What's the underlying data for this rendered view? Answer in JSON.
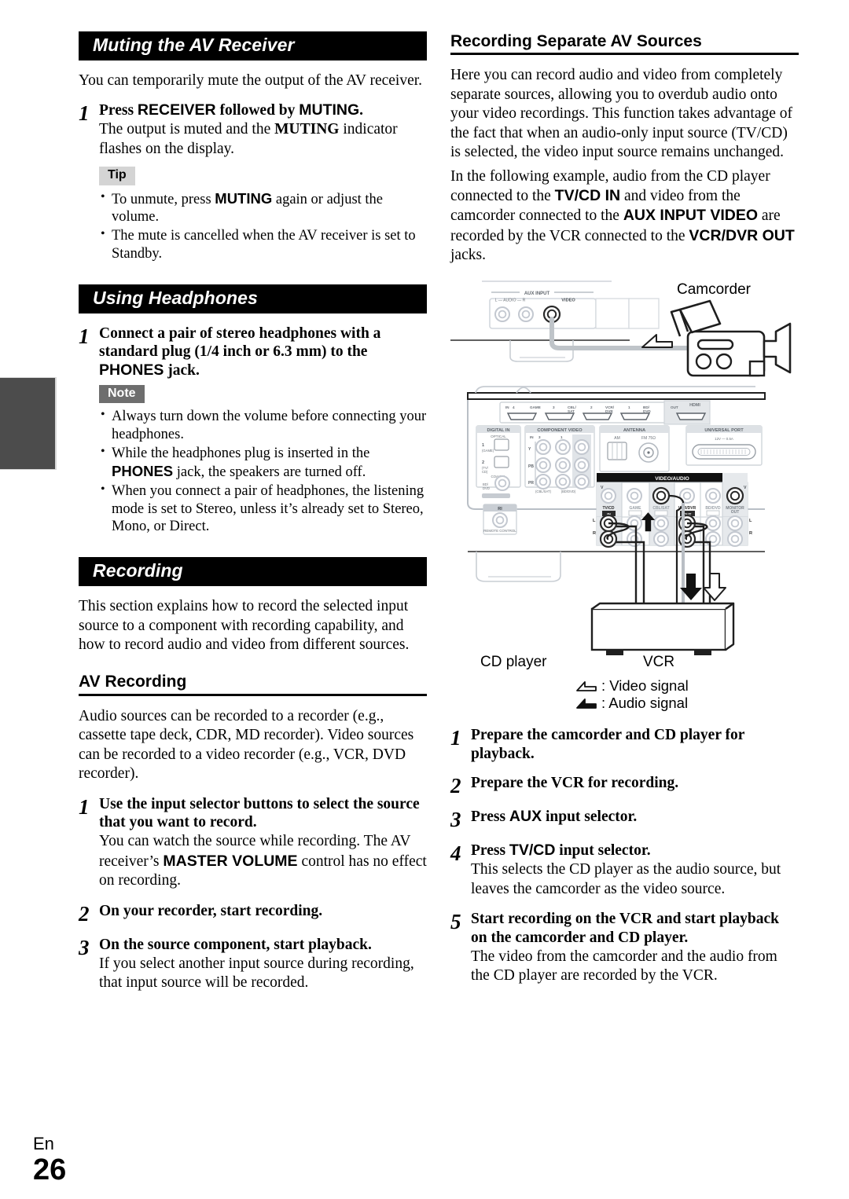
{
  "page": {
    "language_code": "En",
    "page_number": "26"
  },
  "left_column": {
    "section_muting": {
      "banner": "Muting the AV Receiver",
      "intro": "You can temporarily mute the output of the AV receiver.",
      "step": {
        "number": "1",
        "title_parts": [
          "Press ",
          "RECEIVER",
          " followed by ",
          "MUTING",
          "."
        ],
        "desc_parts": [
          "The output is muted and the ",
          "MUTING",
          " indicator flashes on the display."
        ]
      },
      "tip_badge": "Tip",
      "tip_bullets": [
        [
          "To unmute, press ",
          "MUTING",
          " again or adjust the volume."
        ],
        [
          "The mute is cancelled when the AV receiver is set to Standby.",
          "",
          ""
        ]
      ]
    },
    "section_headphones": {
      "banner": "Using Headphones",
      "step": {
        "number": "1",
        "title_parts": [
          "Connect a pair of stereo headphones with a standard plug (1/4 inch or 6.3 mm) to the ",
          "PHONES",
          " jack."
        ]
      },
      "note_badge": "Note",
      "note_bullets": [
        [
          "Always turn down the volume before connecting your headphones.",
          "",
          ""
        ],
        [
          "While the headphones plug is inserted in the ",
          "PHONES",
          " jack, the speakers are turned off."
        ],
        [
          "When you connect a pair of headphones, the listening mode is set to Stereo, unless it’s already set to Stereo, Mono, or Direct.",
          "",
          ""
        ]
      ]
    },
    "section_recording": {
      "banner": "Recording",
      "intro": "This section explains how to record the selected input source to a component with recording capability, and how to record audio and video from different sources.",
      "subhead": "AV Recording",
      "body": "Audio sources can be recorded to a recorder (e.g., cassette tape deck, CDR, MD recorder). Video sources can be recorded to a video recorder (e.g., VCR, DVD recorder).",
      "steps": [
        {
          "number": "1",
          "title": "Use the input selector buttons to select the source that you want to record.",
          "desc_parts": [
            "You can watch the source while recording. The AV receiver’s ",
            "MASTER VOLUME",
            " control has no effect on recording."
          ]
        },
        {
          "number": "2",
          "title": "On your recorder, start recording.",
          "desc_parts": [
            "",
            "",
            ""
          ]
        },
        {
          "number": "3",
          "title": "On the source component, start playback.",
          "desc_parts": [
            "If you select another input source during recording, that input source will be recorded.",
            "",
            ""
          ]
        }
      ]
    }
  },
  "right_column": {
    "subhead": "Recording Separate AV Sources",
    "para1": "Here you can record audio and video from completely separate sources, allowing you to overdub audio onto your video recordings. This function takes advantage of the fact that when an audio-only input source (TV/CD) is selected, the video input source remains unchanged.",
    "para2_parts": [
      "In the following example, audio from the CD player connected to the ",
      "TV/CD IN",
      " and video from the camcorder connected to the ",
      "AUX INPUT VIDEO",
      " are recorded by the VCR connected to the ",
      "VCR/DVR OUT",
      " jacks."
    ],
    "diagram": {
      "camcorder_label": "Camcorder",
      "cd_player_label": "CD player",
      "vcr_label": "VCR",
      "legend": [
        {
          "icon": "video-signal-arrow",
          "text": ": Video signal"
        },
        {
          "icon": "audio-signal-arrow",
          "text": ": Audio signal"
        }
      ],
      "front_panel": {
        "group_label": "AUX INPUT",
        "audio_label": "L — AUDIO — R",
        "video_label": "VIDEO"
      },
      "rear_panel": {
        "hdmi_row": [
          {
            "num": "4",
            "name": "GAME"
          },
          {
            "num": "3",
            "name": "CBL/SAT"
          },
          {
            "num": "2",
            "name": "VCR/DVR"
          },
          {
            "num": "1",
            "name": "BD/DVD"
          },
          {
            "num": "",
            "name": "OUT"
          }
        ],
        "hdmi_title": "HDMI",
        "digital_in": {
          "title": "DIGITAL IN",
          "optical": "OPTICAL",
          "ch1": "1",
          "ch1_name": "GAME",
          "ch2": "2",
          "ch2_name": "TV/CD",
          "coaxial": "COAXIAL",
          "coax_name": "BD/DVD"
        },
        "component_video": {
          "title": "COMPONENT VIDEO",
          "ports": [
            "3",
            "1",
            "OUT"
          ],
          "rows": [
            "Y",
            "PB",
            "PR"
          ],
          "labels": [
            "CBL/SAT",
            "BD/DVD"
          ]
        },
        "antenna": {
          "title": "ANTENNA",
          "am": "AM",
          "fm": "FM 75Ω"
        },
        "video_audio": {
          "title": "VIDEO/AUDIO",
          "columns": [
            "TV/CD",
            "GAME",
            "CBL/SAT",
            "VCR/DVR",
            "BD/DVD",
            "MONITOR OUT"
          ],
          "tvcd_dir": "IN",
          "vcrdvr_dir": "OUT",
          "row_l": "L",
          "row_r": "R",
          "row_v": "V"
        },
        "universal_port": {
          "title": "UNIVERSAL PORT",
          "spec": "12V — 0.5A"
        },
        "remote": {
          "title": "RI",
          "label": "REMOTE CONTROL"
        }
      }
    },
    "steps": [
      {
        "number": "1",
        "title_parts": [
          "Prepare the camcorder and CD player for playback.",
          "",
          ""
        ],
        "desc": ""
      },
      {
        "number": "2",
        "title_parts": [
          "Prepare the VCR for recording.",
          "",
          ""
        ],
        "desc": ""
      },
      {
        "number": "3",
        "title_parts": [
          "Press ",
          "AUX",
          " input selector."
        ],
        "desc": ""
      },
      {
        "number": "4",
        "title_parts": [
          "Press ",
          "TV/CD",
          " input selector."
        ],
        "desc": "This selects the CD player as the audio source, but leaves the camcorder as the video source."
      },
      {
        "number": "5",
        "title_parts": [
          "Start recording on the VCR and start playback on the camcorder and CD player.",
          "",
          ""
        ],
        "desc": "The video from the camcorder and the audio from the CD player are recorded by the VCR."
      }
    ]
  },
  "colors": {
    "banner_bg": "#000000",
    "tip_bg": "#d4d4d4",
    "note_bg": "#6e6e6e",
    "tab_bg": "#4c4c4c"
  }
}
